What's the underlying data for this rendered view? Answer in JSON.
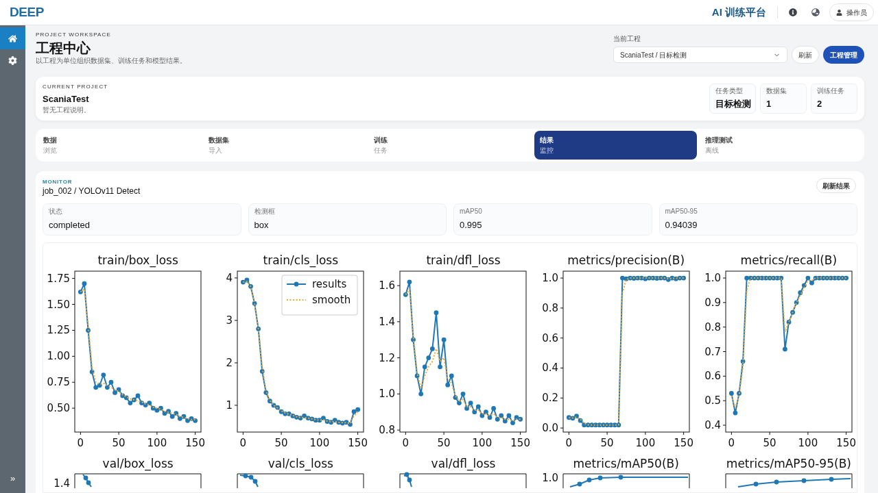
{
  "topbar": {
    "logo": "DEEP",
    "platform_title": "AI 训练平台",
    "user_label": "操作员"
  },
  "sidebar": {
    "items": [
      {
        "selected": true
      },
      {
        "selected": false
      }
    ],
    "expand_label": "»"
  },
  "header": {
    "eyebrow": "PROJECT WORKSPACE",
    "title": "工程中心",
    "subtitle": "以工程为单位组织数据集、训练任务和模型结果。",
    "project_select": {
      "label": "当前工程",
      "value": "ScaniaTest / 目标检测"
    },
    "buttons": [
      {
        "label": "刷新",
        "kind": "secondary"
      },
      {
        "label": "工程管理",
        "kind": "primary"
      }
    ]
  },
  "project_card": {
    "eyebrow": "CURRENT PROJECT",
    "name": "ScaniaTest",
    "description": "暂无工程说明。",
    "stats": [
      {
        "label": "任务类型",
        "value": "目标检测"
      },
      {
        "label": "数据集",
        "value": "1"
      },
      {
        "label": "训练任务",
        "value": "2"
      }
    ]
  },
  "steps": [
    {
      "title": "数据",
      "subtitle": "浏览",
      "selected": false
    },
    {
      "title": "数据集",
      "subtitle": "导入",
      "selected": false
    },
    {
      "title": "训练",
      "subtitle": "任务",
      "selected": false
    },
    {
      "title": "结果",
      "subtitle": "监控",
      "selected": true
    },
    {
      "title": "推理测试",
      "subtitle": "离线",
      "selected": false
    }
  ],
  "monitor": {
    "eyebrow": "MONITOR",
    "job_title": "job_002 / YOLOv11 Detect",
    "refresh_button": "刷新结果",
    "metrics": [
      {
        "label": "状态",
        "value": "completed"
      },
      {
        "label": "检测框",
        "value": "box"
      },
      {
        "label": "mAP50",
        "value": "0.995"
      },
      {
        "label": "mAP50-95",
        "value": "0.94039"
      }
    ],
    "plots": [
      {
        "chart_data": {
          "type": "line",
          "title": "train/box_loss",
          "x": [
            0,
            5,
            10,
            15,
            20,
            25,
            30,
            35,
            40,
            45,
            50,
            55,
            60,
            65,
            70,
            75,
            80,
            85,
            90,
            95,
            100,
            105,
            110,
            115,
            120,
            125,
            130,
            135,
            140,
            145,
            150
          ],
          "series": [
            {
              "color": "#1f77b4",
              "line_style": "solid",
              "marker": "circle",
              "values": [
                1.62,
                1.7,
                1.25,
                0.85,
                0.7,
                0.72,
                0.82,
                0.7,
                0.75,
                0.65,
                0.68,
                0.62,
                0.6,
                0.55,
                0.58,
                0.62,
                0.55,
                0.53,
                0.55,
                0.5,
                0.48,
                0.5,
                0.45,
                0.47,
                0.42,
                0.45,
                0.4,
                0.42,
                0.38,
                0.4,
                0.38
              ]
            },
            {
              "color": "#f0a830",
              "line_style": "dotted",
              "values": [
                1.62,
                1.65,
                1.3,
                0.9,
                0.75,
                0.73,
                0.74,
                0.72,
                0.7,
                0.68,
                0.66,
                0.63,
                0.61,
                0.59,
                0.58,
                0.57,
                0.56,
                0.54,
                0.53,
                0.51,
                0.5,
                0.49,
                0.47,
                0.46,
                0.45,
                0.44,
                0.42,
                0.41,
                0.4,
                0.39,
                0.39
              ]
            }
          ],
          "xlim": [
            -7.5,
            157.5
          ],
          "ylim": [
            0.27,
            1.82
          ],
          "xticks": [
            0,
            50,
            100,
            150
          ],
          "yticks": [
            {
              "value": 0.5,
              "label": "0.50"
            },
            0.75,
            {
              "value": 1,
              "label": "1.00"
            },
            1.25,
            {
              "value": 1.5,
              "label": "1.50"
            },
            1.75
          ]
        }
      },
      {
        "chart_data": {
          "type": "line",
          "title": "train/cls_loss",
          "x": [
            0,
            5,
            10,
            15,
            20,
            25,
            30,
            35,
            40,
            45,
            50,
            55,
            60,
            65,
            70,
            75,
            80,
            85,
            90,
            95,
            100,
            105,
            110,
            115,
            120,
            125,
            130,
            135,
            140,
            145,
            150
          ],
          "series": [
            {
              "name": "results",
              "color": "#1f77b4",
              "line_style": "solid",
              "marker": "circle",
              "values": [
                3.9,
                3.95,
                3.8,
                3.4,
                2.8,
                1.8,
                1.3,
                1.1,
                1.0,
                0.95,
                0.85,
                0.8,
                0.8,
                0.75,
                0.72,
                0.7,
                0.75,
                0.7,
                0.68,
                0.65,
                0.65,
                0.7,
                0.62,
                0.6,
                0.65,
                0.6,
                0.58,
                0.6,
                0.55,
                0.85,
                0.9
              ]
            },
            {
              "name": "smooth",
              "color": "#f0a830",
              "line_style": "dotted",
              "values": [
                3.9,
                3.92,
                3.8,
                3.4,
                2.8,
                1.9,
                1.35,
                1.12,
                1.0,
                0.94,
                0.87,
                0.82,
                0.79,
                0.76,
                0.73,
                0.71,
                0.71,
                0.7,
                0.68,
                0.66,
                0.65,
                0.66,
                0.63,
                0.61,
                0.62,
                0.6,
                0.59,
                0.59,
                0.57,
                0.75,
                0.85
              ]
            }
          ],
          "legend": "upper right",
          "xlim": [
            -7.5,
            157.5
          ],
          "ylim": [
            0.37,
            4.16
          ],
          "xticks": [
            0,
            50,
            100,
            150
          ],
          "yticks": [
            1,
            2,
            3,
            4
          ]
        }
      },
      {
        "chart_data": {
          "type": "line",
          "title": "train/dfl_loss",
          "x": [
            0,
            5,
            10,
            15,
            20,
            25,
            30,
            35,
            40,
            45,
            50,
            55,
            60,
            65,
            70,
            75,
            80,
            85,
            90,
            95,
            100,
            105,
            110,
            115,
            120,
            125,
            130,
            135,
            140,
            145,
            150
          ],
          "series": [
            {
              "color": "#1f77b4",
              "line_style": "solid",
              "marker": "circle",
              "values": [
                1.55,
                1.62,
                1.3,
                1.1,
                1.0,
                1.15,
                1.2,
                1.25,
                1.45,
                1.15,
                1.3,
                1.05,
                1.1,
                0.98,
                0.95,
                1.0,
                0.92,
                0.95,
                0.9,
                0.93,
                0.88,
                0.9,
                0.87,
                0.92,
                0.86,
                0.88,
                0.85,
                0.88,
                0.84,
                0.87,
                0.86
              ]
            },
            {
              "color": "#f0a830",
              "line_style": "dotted",
              "values": [
                1.55,
                1.58,
                1.32,
                1.12,
                1.03,
                1.1,
                1.15,
                1.18,
                1.25,
                1.18,
                1.2,
                1.08,
                1.06,
                0.99,
                0.96,
                0.97,
                0.93,
                0.93,
                0.91,
                0.91,
                0.89,
                0.89,
                0.88,
                0.89,
                0.87,
                0.87,
                0.86,
                0.86,
                0.85,
                0.86,
                0.86
              ]
            }
          ],
          "xlim": [
            -7.5,
            157.5
          ],
          "ylim": [
            0.789,
            1.68
          ],
          "xticks": [
            0,
            50,
            100,
            150
          ],
          "yticks": [
            0.8,
            {
              "value": 1,
              "label": "1.0"
            },
            1.2,
            1.4,
            1.6
          ]
        }
      },
      {
        "chart_data": {
          "type": "line",
          "title": "metrics/precision(B)",
          "x": [
            0,
            5,
            10,
            15,
            20,
            25,
            30,
            35,
            40,
            45,
            50,
            55,
            60,
            65,
            70,
            75,
            80,
            85,
            90,
            95,
            100,
            105,
            110,
            115,
            120,
            125,
            130,
            135,
            140,
            145,
            150
          ],
          "series": [
            {
              "color": "#1f77b4",
              "line_style": "solid",
              "marker": "circle",
              "values": [
                0.07,
                0.065,
                0.08,
                0.05,
                0.02,
                0.02,
                0.02,
                0.02,
                0.02,
                0.02,
                0.02,
                0.02,
                0.02,
                0.02,
                1.0,
                0.995,
                1.0,
                0.998,
                1.0,
                1.0,
                0.995,
                1.0,
                1.0,
                0.998,
                1.0,
                1.0,
                0.99,
                1.0,
                0.995,
                1.0,
                1.0
              ]
            },
            {
              "color": "#f0a830",
              "line_style": "dotted",
              "values": [
                0.07,
                0.067,
                0.072,
                0.06,
                0.03,
                0.022,
                0.02,
                0.02,
                0.02,
                0.02,
                0.02,
                0.02,
                0.02,
                0.02,
                0.9,
                0.99,
                1.0,
                1.0,
                1.0,
                1.0,
                1.0,
                1.0,
                1.0,
                1.0,
                1.0,
                1.0,
                0.995,
                0.998,
                0.998,
                1.0,
                1.0
              ]
            }
          ],
          "xlim": [
            -7.5,
            157.5
          ],
          "ylim": [
            -0.027,
            1.046
          ],
          "xticks": [
            0,
            50,
            100,
            150
          ],
          "yticks": [
            {
              "value": 0,
              "label": "0.0"
            },
            0.2,
            0.4,
            0.6,
            0.8,
            {
              "value": 1,
              "label": "1.0"
            }
          ]
        }
      },
      {
        "chart_data": {
          "type": "line",
          "title": "metrics/recall(B)",
          "x": [
            0,
            5,
            10,
            15,
            20,
            25,
            30,
            35,
            40,
            45,
            50,
            55,
            60,
            65,
            70,
            75,
            80,
            85,
            90,
            95,
            100,
            105,
            110,
            115,
            120,
            125,
            130,
            135,
            140,
            145,
            150
          ],
          "series": [
            {
              "color": "#1f77b4",
              "line_style": "solid",
              "marker": "circle",
              "values": [
                0.53,
                0.45,
                0.53,
                0.66,
                1.0,
                1.0,
                1.0,
                1.0,
                1.0,
                1.0,
                1.0,
                1.0,
                1.0,
                1.0,
                0.71,
                0.82,
                0.86,
                0.9,
                0.94,
                0.97,
                1.0,
                0.98,
                1.0,
                1.0,
                1.0,
                1.0,
                1.0,
                1.0,
                1.0,
                1.0,
                1.0
              ]
            },
            {
              "color": "#f0a830",
              "line_style": "dotted",
              "values": [
                0.52,
                0.47,
                0.52,
                0.64,
                0.95,
                1.0,
                1.0,
                1.0,
                1.0,
                1.0,
                1.0,
                1.0,
                1.0,
                1.0,
                0.78,
                0.82,
                0.86,
                0.9,
                0.93,
                0.96,
                0.99,
                0.99,
                1.0,
                1.0,
                1.0,
                1.0,
                1.0,
                1.0,
                1.0,
                1.0,
                1.0
              ]
            }
          ],
          "xlim": [
            -7.5,
            157.5
          ],
          "ylim": [
            0.372,
            1.028
          ],
          "xticks": [
            0,
            50,
            100,
            150
          ],
          "yticks": [
            0.4,
            0.5,
            0.6,
            0.7,
            0.8,
            0.9,
            {
              "value": 1,
              "label": "1.0"
            }
          ]
        }
      }
    ],
    "cut_plots": [
      {
        "title": "val/box_loss",
        "ytick": "1.4"
      },
      {
        "title": "val/cls_loss"
      },
      {
        "title": "val/dfl_loss"
      },
      {
        "title": "metrics/mAP50(B)",
        "ytick": "1.0"
      },
      {
        "title": "metrics/mAP50-95(B)"
      }
    ]
  }
}
